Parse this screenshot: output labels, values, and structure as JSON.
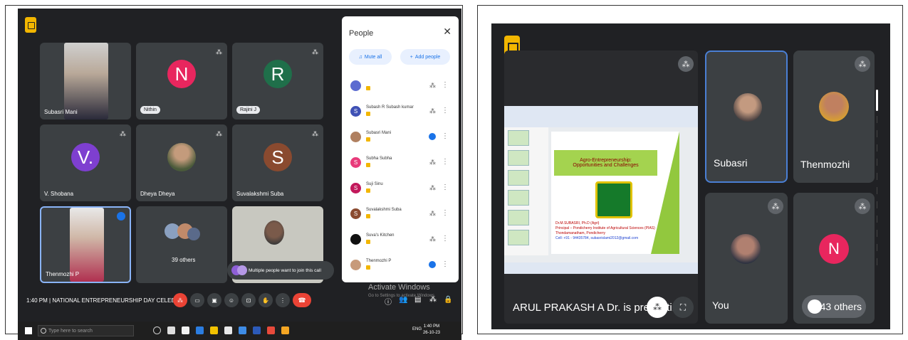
{
  "left": {
    "participants": [
      {
        "name": "Subasri Mani",
        "type": "photo"
      },
      {
        "name": "Nithin",
        "initial": "N",
        "type": "avatar",
        "color": "#e8265e"
      },
      {
        "name": "Rajini J",
        "initial": "R",
        "type": "avatar",
        "color": "#1f6f4a"
      },
      {
        "name": "V. Shobana",
        "initial": "V.",
        "type": "avatar",
        "color": "#7e3fd0"
      },
      {
        "name": "Dheya Dheya",
        "type": "photo"
      },
      {
        "name": "Suvalakshmi Suba",
        "initial": "S",
        "type": "avatar",
        "color": "#8a4a2f"
      },
      {
        "name": "Thenmozhi P",
        "type": "photo"
      },
      {
        "name": "39 others",
        "type": "group"
      },
      {
        "name": "",
        "type": "photo"
      }
    ],
    "people_panel": {
      "title": "People",
      "mute_all": "Mute all",
      "add_people": "Add people",
      "list": [
        {
          "name": "",
          "initial": "",
          "color": "#5b6bd0",
          "mic": "off"
        },
        {
          "name": "Subash R Subash kumar",
          "initial": "S",
          "color": "#3f51b5",
          "mic": "off"
        },
        {
          "name": "Subasri Mani",
          "initial": "",
          "color": "#b08060",
          "mic": "on"
        },
        {
          "name": "Subha Subha",
          "initial": "S",
          "color": "#e83a7a",
          "mic": "off"
        },
        {
          "name": "Suji Sinu",
          "initial": "S",
          "color": "#c2185b",
          "mic": "off"
        },
        {
          "name": "Suvalakshmi Suba",
          "initial": "S",
          "color": "#8a4a2f",
          "mic": "off"
        },
        {
          "name": "Suva's Kitchen",
          "initial": "",
          "color": "#111111",
          "mic": "off"
        },
        {
          "name": "Thenmozhi P",
          "initial": "",
          "color": "#c79a7a",
          "mic": "on"
        }
      ]
    },
    "notice": "Multiple people want to join this call",
    "meeting_info": "1:40 PM | NATIONAL ENTREPRENEURSHIP DAY CELEB...",
    "watermark": {
      "title": "Activate Windows",
      "subtitle": "Go to Settings to activate Windows."
    },
    "taskbar": {
      "search_placeholder": "Type here to search",
      "lang": "ENG",
      "time": "1:40 PM",
      "date": "26-10-23"
    }
  },
  "right": {
    "presenter_label": "ARUL PRAKASH A Dr. is presenting",
    "slide": {
      "title_line1": "Agro-Entrepreneurship:",
      "title_line2": "Opportunities and Challenges",
      "author": "Dr.M.SUBASRI, Ph.D (Agri)",
      "affiliation": "Principal – Pondicherry Institute of Agricultural Sciences (PIAS)",
      "address": "Thondamanatham, Pondicherry",
      "contact": "Cell: +91 - 94435784,  subasrislami2012@gmail.com"
    },
    "tiles": [
      {
        "name": "Subasri"
      },
      {
        "name": "Thenmozhi"
      },
      {
        "name": "You"
      },
      {
        "name": "",
        "initial": "N",
        "color": "#e8265e"
      }
    ],
    "others_label": "43 others"
  }
}
